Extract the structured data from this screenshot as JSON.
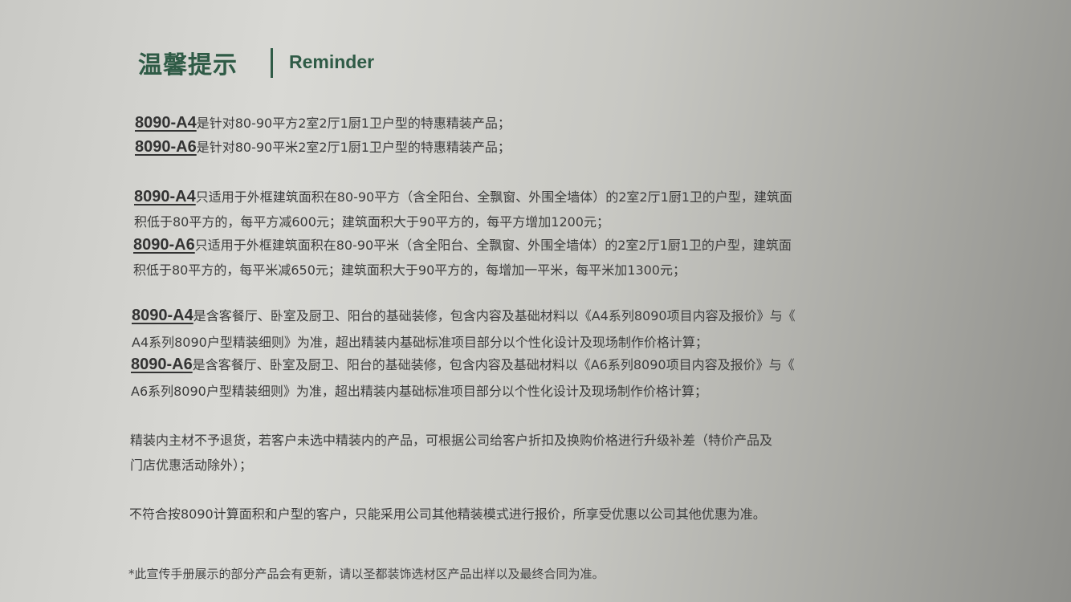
{
  "header": {
    "title": "温馨提示",
    "title_en": "Reminder"
  },
  "sections": [
    {
      "lines": [
        {
          "code": "8090-A4",
          "text": "是针对80-90平方2室2厅1厨1卫户型的特惠精装产品；"
        },
        {
          "code": "8090-A6",
          "text": "是针对80-90平米2室2厅1厨1卫户型的特惠精装产品；"
        }
      ]
    },
    {
      "lines": [
        {
          "code": "8090-A4",
          "text": "只适用于外框建筑面积在80-90平方（含全阳台、全飘窗、外围全墙体）的2室2厅1厨1卫的户型，建筑面"
        },
        {
          "code": "",
          "text": "积低于80平方的，每平方减600元；建筑面积大于90平方的，每平方增加1200元；"
        },
        {
          "code": "8090-A6",
          "text": "只适用于外框建筑面积在80-90平米（含全阳台、全飘窗、外围全墙体）的2室2厅1厨1卫的户型，建筑面"
        },
        {
          "code": "",
          "text": "积低于80平方的，每平米减650元；建筑面积大于90平方的，每增加一平米，每平米加1300元；"
        }
      ]
    },
    {
      "lines": [
        {
          "code": "8090-A4",
          "text": "是含客餐厅、卧室及厨卫、阳台的基础装修，包含内容及基础材料以《A4系列8090项目内容及报价》与《"
        },
        {
          "code": "",
          "text": "A4系列8090户型精装细则》为准，超出精装内基础标准项目部分以个性化设计及现场制作价格计算；"
        },
        {
          "code": "8090-A6",
          "text": "是含客餐厅、卧室及厨卫、阳台的基础装修，包含内容及基础材料以《A6系列8090项目内容及报价》与《"
        },
        {
          "code": "",
          "text": "A6系列8090户型精装细则》为准，超出精装内基础标准项目部分以个性化设计及现场制作价格计算；"
        }
      ]
    },
    {
      "lines": [
        {
          "code": "",
          "text": "精装内主材不予退货，若客户未选中精装内的产品，可根据公司给客户折扣及换购价格进行升级补差（特价产品及"
        },
        {
          "code": "",
          "text": "门店优惠活动除外）；"
        }
      ]
    },
    {
      "lines": [
        {
          "code": "",
          "text": "不符合按8090计算面积和户型的客户，只能采用公司其他精装模式进行报价，所享受优惠以公司其他优惠为准。"
        }
      ]
    }
  ],
  "footnote": "*此宣传手册展示的部分产品会有更新，请以圣都装饰选材区产品出样以及最终合同为准。"
}
